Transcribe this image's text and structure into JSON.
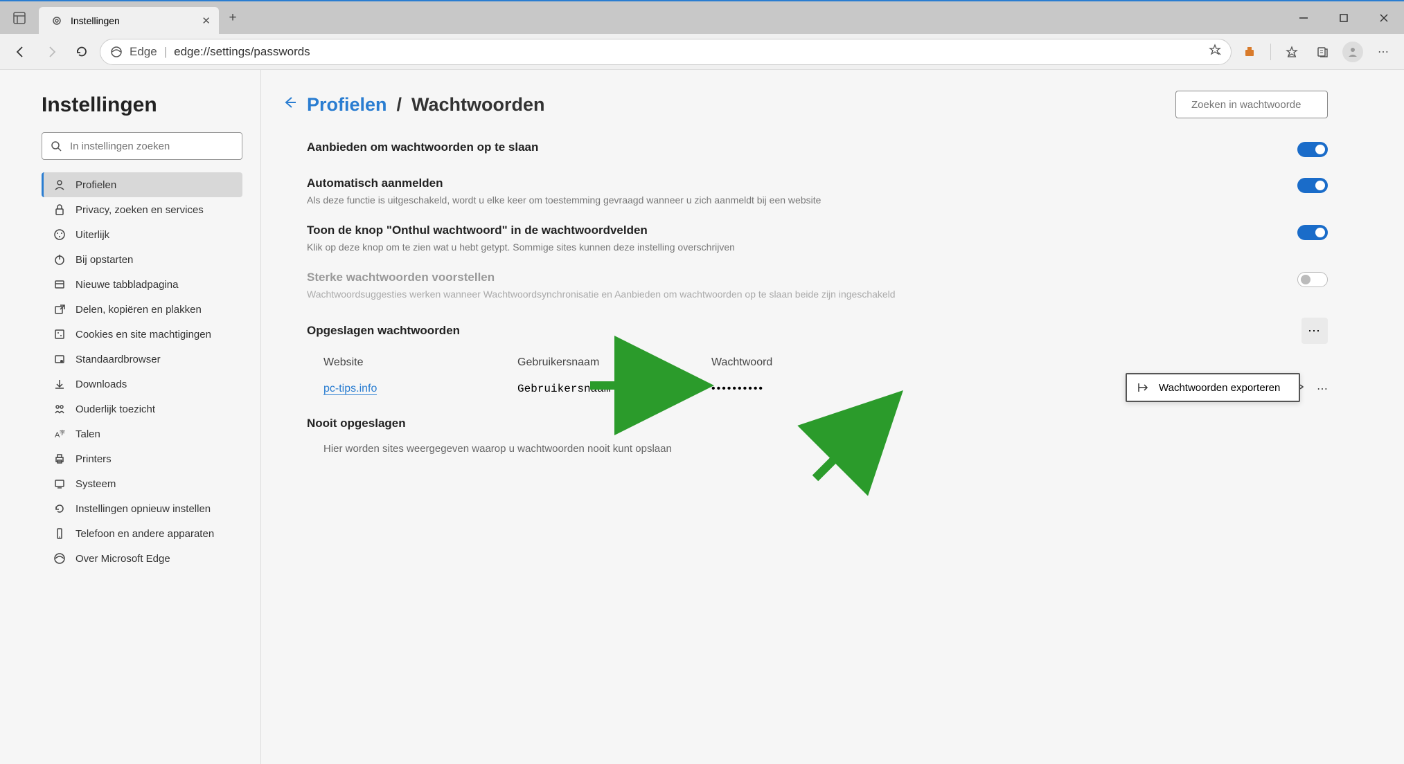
{
  "tab": {
    "title": "Instellingen"
  },
  "address": {
    "label": "Edge",
    "url": "edge://settings/passwords"
  },
  "sidebar": {
    "title": "Instellingen",
    "search_placeholder": "In instellingen zoeken",
    "items": [
      {
        "label": "Profielen",
        "icon": "profile-icon"
      },
      {
        "label": "Privacy, zoeken en services",
        "icon": "lock-icon"
      },
      {
        "label": "Uiterlijk",
        "icon": "palette-icon"
      },
      {
        "label": "Bij opstarten",
        "icon": "power-icon"
      },
      {
        "label": "Nieuwe tabbladpagina",
        "icon": "tab-icon"
      },
      {
        "label": "Delen, kopiëren en plakken",
        "icon": "share-icon"
      },
      {
        "label": "Cookies en site machtigingen",
        "icon": "cookie-icon"
      },
      {
        "label": "Standaardbrowser",
        "icon": "browser-icon"
      },
      {
        "label": "Downloads",
        "icon": "download-icon"
      },
      {
        "label": "Ouderlijk toezicht",
        "icon": "family-icon"
      },
      {
        "label": "Talen",
        "icon": "language-icon"
      },
      {
        "label": "Printers",
        "icon": "printer-icon"
      },
      {
        "label": "Systeem",
        "icon": "system-icon"
      },
      {
        "label": "Instellingen opnieuw instellen",
        "icon": "reset-icon"
      },
      {
        "label": "Telefoon en andere apparaten",
        "icon": "phone-icon"
      },
      {
        "label": "Over Microsoft Edge",
        "icon": "edge-icon"
      }
    ]
  },
  "breadcrumb": {
    "parent": "Profielen",
    "current": "Wachtwoorden"
  },
  "page_search": {
    "placeholder": "Zoeken in wachtwoorde"
  },
  "settings": [
    {
      "title": "Aanbieden om wachtwoorden op te slaan",
      "desc": "",
      "enabled": true
    },
    {
      "title": "Automatisch aanmelden",
      "desc": "Als deze functie is uitgeschakeld, wordt u elke keer om toestemming gevraagd wanneer u zich aanmeldt bij een website",
      "enabled": true
    },
    {
      "title": "Toon de knop \"Onthul wachtwoord\" in de wachtwoordvelden",
      "desc": "Klik op deze knop om te zien wat u hebt getypt. Sommige sites kunnen deze instelling overschrijven",
      "enabled": true
    },
    {
      "title": "Sterke wachtwoorden voorstellen",
      "desc": "Wachtwoordsuggesties werken wanneer Wachtwoordsynchronisatie en Aanbieden om wachtwoorden op te slaan beide zijn ingeschakeld",
      "enabled": false
    }
  ],
  "saved_passwords": {
    "heading": "Opgeslagen wachtwoorden",
    "columns": {
      "site": "Website",
      "user": "Gebruikersnaam",
      "pw": "Wachtwoord"
    },
    "rows": [
      {
        "site": "pc-tips.info",
        "user": "Gebruikersnaam",
        "pw": "••••••••••"
      }
    ]
  },
  "never_saved": {
    "heading": "Nooit opgeslagen",
    "desc": "Hier worden sites weergegeven waarop u wachtwoorden nooit kunt opslaan"
  },
  "popup": {
    "export_label": "Wachtwoorden exporteren"
  }
}
